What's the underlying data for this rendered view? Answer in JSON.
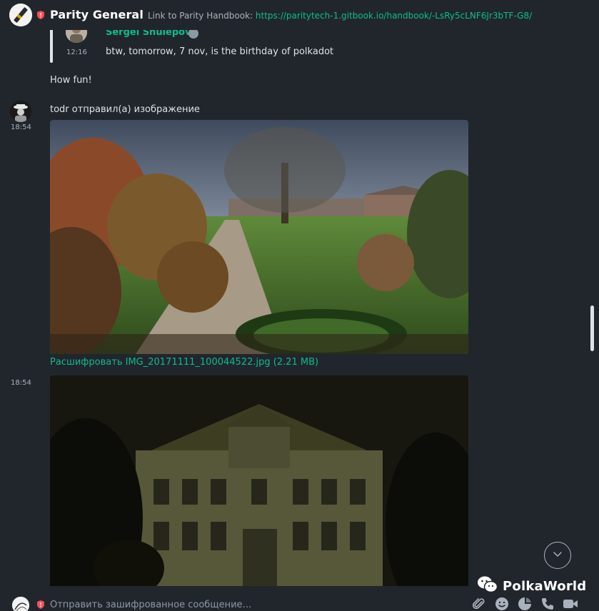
{
  "room": {
    "title": "Parity General",
    "topic_prefix": "Link to Parity Handbook: ",
    "topic_link": "https://paritytech-1.gitbook.io/handbook/-LsRy5cLNF6Jr3bTF-G8/"
  },
  "quoted": {
    "sender": "Sergei Shulepov",
    "time": "12:16",
    "body": "btw, tomorrow, 7 nov, is the birthday of polkadot"
  },
  "messages": [
    {
      "body": "How fun!"
    },
    {
      "time": "18:54",
      "body": "todr отправил(а) изображение"
    },
    {
      "time": "18:54"
    }
  ],
  "attachment": {
    "decrypt_label": "Расшифровать IMG_20171111_100044522.jpg (2.21 MB)"
  },
  "composer": {
    "placeholder": "Отправить зашифрованное сообщение…"
  },
  "watermark": {
    "text": "PolkaWorld"
  },
  "icons": [
    "shield-icon",
    "verified-icon",
    "chevron-down-icon",
    "paperclip-icon",
    "emoji-icon",
    "sticker-icon",
    "phone-icon",
    "video-icon",
    "wechat-icon"
  ],
  "colors": {
    "background": "#21262c",
    "accent": "#0dbd8b",
    "text": "#dfe1e4",
    "muted": "#a9b2bc",
    "warning": "#ff4b55"
  }
}
